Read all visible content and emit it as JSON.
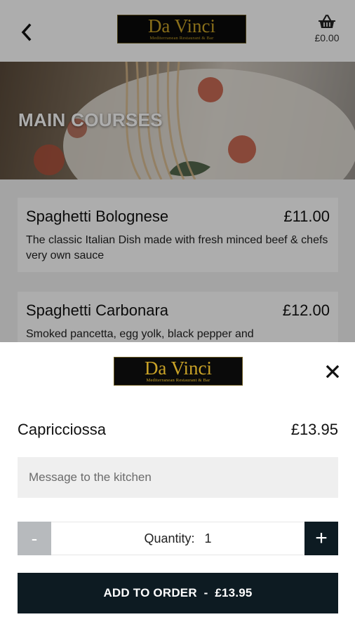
{
  "header": {
    "logo_title": "Da Vinci",
    "logo_subtitle": "Mediterranean Restaurant & Bar",
    "basket_total": "£0.00"
  },
  "hero": {
    "title": "MAIN COURSES"
  },
  "menu": {
    "items": [
      {
        "name": "Spaghetti Bolognese",
        "price": "£11.00",
        "description": "The classic Italian Dish made with fresh minced beef & chefs very own sauce"
      },
      {
        "name": "Spaghetti Carbonara",
        "price": "£12.00",
        "description": "Smoked pancetta, egg yolk, black pepper and"
      }
    ]
  },
  "sheet": {
    "logo_title": "Da Vinci",
    "logo_subtitle": "Mediterranean Restaurant & Bar",
    "product_name": "Capricciossa",
    "product_price": "£13.95",
    "message_placeholder": "Message to the kitchen",
    "quantity_label": "Quantity:",
    "quantity_value": "1",
    "minus_label": "-",
    "plus_label": "+",
    "add_label": "ADD TO ORDER  -  £13.95"
  },
  "colors": {
    "brand_dark": "#0d1b22",
    "logo_gold": "#c9a227",
    "minus_disabled": "#b7babd"
  },
  "icons": {
    "back": "chevron-left-icon",
    "basket": "basket-icon",
    "close": "close-icon"
  }
}
